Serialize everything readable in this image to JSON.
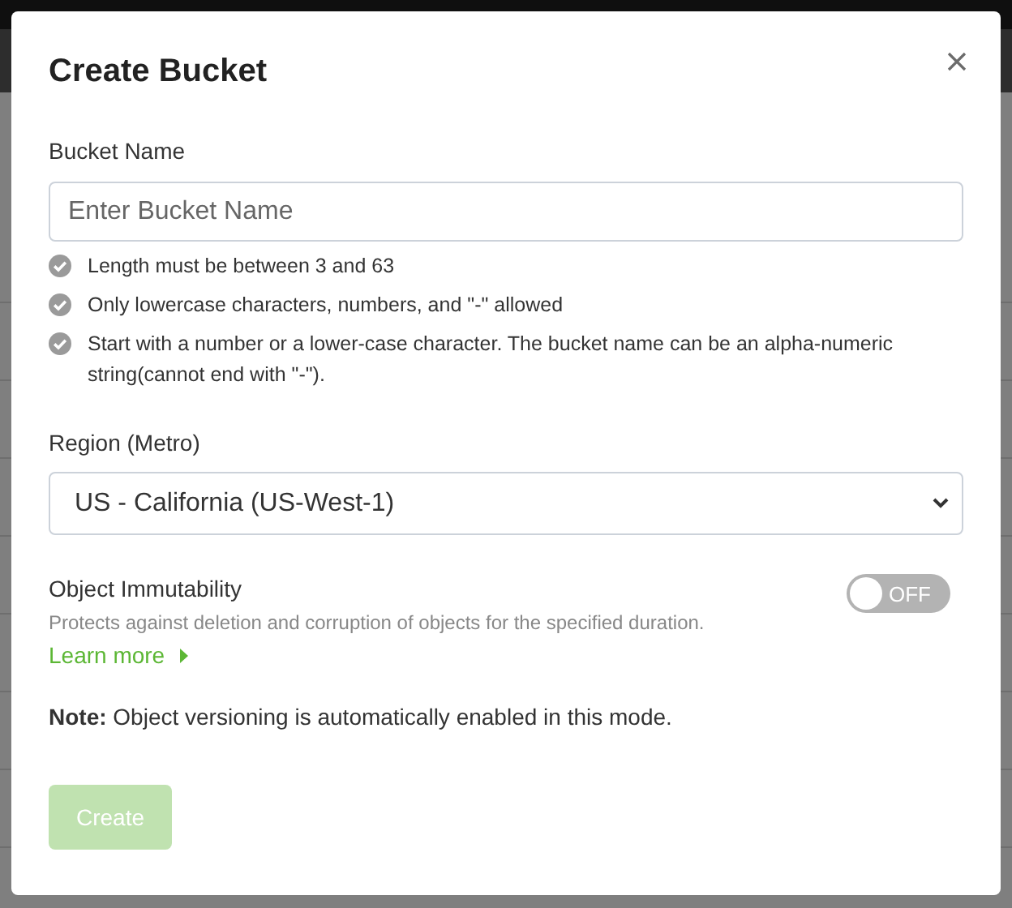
{
  "dialog": {
    "title": "Create Bucket",
    "bucket_name": {
      "label": "Bucket Name",
      "placeholder": "Enter Bucket Name"
    },
    "rules": [
      {
        "text": "Length must be between 3 and 63"
      },
      {
        "text": "Only lowercase characters, numbers, and \"-\" allowed"
      },
      {
        "text": "Start with a number or a lower-case character. The bucket name can be an alpha-numeric string(cannot end with \"-\")."
      }
    ],
    "region": {
      "label": "Region (Metro)",
      "value": "US - California (US-West-1)"
    },
    "immutability": {
      "label": "Object Immutability",
      "description": "Protects against deletion and corruption of objects for the specified duration.",
      "link": "Learn more",
      "toggle": {
        "on": false,
        "text": "OFF"
      }
    },
    "note": "**Note:** Object versioning is automatically enabled in this mode.",
    "create_button": {
      "label": "Create",
      "disabled": true
    }
  }
}
